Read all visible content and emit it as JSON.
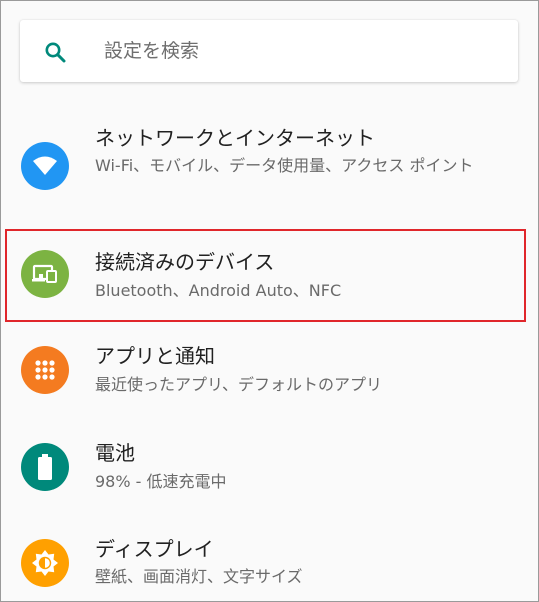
{
  "search": {
    "placeholder": "設定を検索",
    "icon": "search-icon"
  },
  "accent": "#00897b",
  "items": [
    {
      "title": "ネットワークとインターネット",
      "subtitle": "Wi-Fi、モバイル、データ使用量、アクセス ポイント",
      "icon": "wifi-icon",
      "color": "#2196f3"
    },
    {
      "title": "接続済みのデバイス",
      "subtitle": "Bluetooth、Android Auto、NFC",
      "icon": "connected-devices-icon",
      "color": "#7cb342"
    },
    {
      "title": "アプリと通知",
      "subtitle": "最近使ったアプリ、デフォルトのアプリ",
      "icon": "apps-grid-icon",
      "color": "#f47b20"
    },
    {
      "title": "電池",
      "subtitle": "98% - 低速充電中",
      "icon": "battery-icon",
      "color": "#00897b"
    },
    {
      "title": "ディスプレイ",
      "subtitle": "壁紙、画面消灯、文字サイズ",
      "icon": "brightness-icon",
      "color": "#ffa000"
    }
  ]
}
